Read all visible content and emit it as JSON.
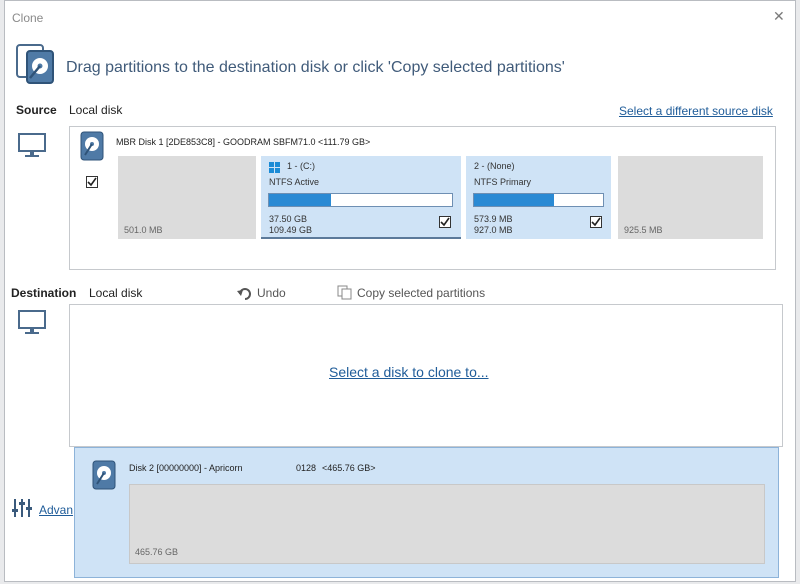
{
  "window": {
    "title": "Clone",
    "close_glyph": "✕"
  },
  "header": {
    "text": "Drag partitions to the destination disk or click 'Copy selected partitions'",
    "icon": "clone-wizard-icon"
  },
  "source": {
    "label": "Source",
    "disk_type": "Local disk",
    "change_link": "Select a different source disk",
    "disk": {
      "title": "MBR Disk 1 [2DE853C8] - GOODRAM SBFM71.0  <111.79 GB>",
      "checked": true,
      "partitions": [
        {
          "kind": "unallocated",
          "size": "501.0 MB"
        },
        {
          "kind": "partition",
          "name": "1 -  (C:)",
          "fs": "NTFS Active",
          "used": "37.50 GB",
          "total": "109.49 GB",
          "used_fraction": 0.34,
          "checked": true,
          "os_icon": "windows-logo-icon"
        },
        {
          "kind": "partition",
          "name": "2 -  (None)",
          "fs": "NTFS Primary",
          "used": "573.9 MB",
          "total": "927.0 MB",
          "used_fraction": 0.62,
          "checked": true
        },
        {
          "kind": "unallocated",
          "size": "925.5 MB"
        }
      ]
    }
  },
  "destination": {
    "label": "Destination",
    "disk_type": "Local disk",
    "undo_label": "Undo",
    "copy_label": "Copy selected partitions",
    "placeholder_link": "Select a disk to clone to..."
  },
  "dropdown": {
    "disk_name": "Disk 2 [00000000] - Apricorn",
    "disk_model": "0128",
    "disk_size": "<465.76 GB>",
    "unallocated": "465.76 GB"
  },
  "footer": {
    "advanced_label": "Advan"
  },
  "colors": {
    "accent": "#2a8ad4",
    "selection": "#cfe3f6",
    "link": "#1f5c99"
  }
}
